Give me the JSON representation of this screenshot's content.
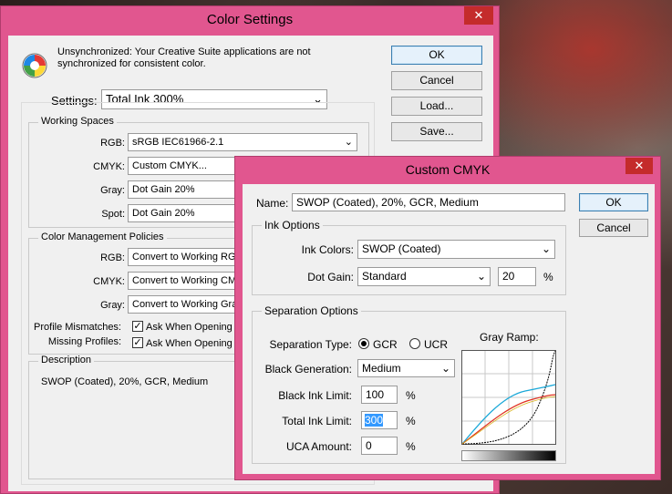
{
  "color_settings": {
    "title": "Color Settings",
    "close": "✕",
    "message": "Unsynchronized: Your Creative Suite applications are not synchronized for consistent color.",
    "settings_label": "Settings:",
    "settings_value": "Total Ink 300%",
    "buttons": {
      "ok": "OK",
      "cancel": "Cancel",
      "load": "Load...",
      "save": "Save..."
    },
    "working_spaces": {
      "label": "Working Spaces",
      "rgb_label": "RGB:",
      "rgb_value": "sRGB IEC61966-2.1",
      "cmyk_label": "CMYK:",
      "cmyk_value": "Custom CMYK...",
      "gray_label": "Gray:",
      "gray_value": "Dot Gain 20%",
      "spot_label": "Spot:",
      "spot_value": "Dot Gain 20%"
    },
    "policies": {
      "label": "Color Management Policies",
      "rgb_label": "RGB:",
      "rgb_value": "Convert to Working RGB",
      "cmyk_label": "CMYK:",
      "cmyk_value": "Convert to Working CMYK",
      "gray_label": "Gray:",
      "gray_value": "Convert to Working Gray",
      "mismatch_label": "Profile Mismatches:",
      "mismatch_check": "Ask When Opening",
      "missing_label": "Missing Profiles:",
      "missing_check": "Ask When Opening"
    },
    "description": {
      "label": "Description",
      "text": "SWOP (Coated), 20%, GCR, Medium"
    }
  },
  "custom_cmyk": {
    "title": "Custom CMYK",
    "close": "✕",
    "name_label": "Name:",
    "name_value": "SWOP (Coated), 20%, GCR, Medium",
    "buttons": {
      "ok": "OK",
      "cancel": "Cancel"
    },
    "ink_options": {
      "label": "Ink Options",
      "ink_colors_label": "Ink Colors:",
      "ink_colors_value": "SWOP (Coated)",
      "dot_gain_label": "Dot Gain:",
      "dot_gain_value": "Standard",
      "dot_gain_amount": "20",
      "percent": "%"
    },
    "separation": {
      "label": "Separation Options",
      "type_label": "Separation Type:",
      "gcr": "GCR",
      "ucr": "UCR",
      "black_gen_label": "Black Generation:",
      "black_gen_value": "Medium",
      "black_limit_label": "Black Ink Limit:",
      "black_limit_value": "100",
      "total_limit_label": "Total Ink Limit:",
      "total_limit_value": "300",
      "uca_label": "UCA Amount:",
      "uca_value": "0",
      "percent": "%",
      "gray_ramp_label": "Gray Ramp:"
    }
  },
  "colors": {
    "titlebar": "#e1568f",
    "close": "#c42b2b",
    "cyan_curve": "#19a8d8",
    "red_curve": "#e0301e"
  }
}
